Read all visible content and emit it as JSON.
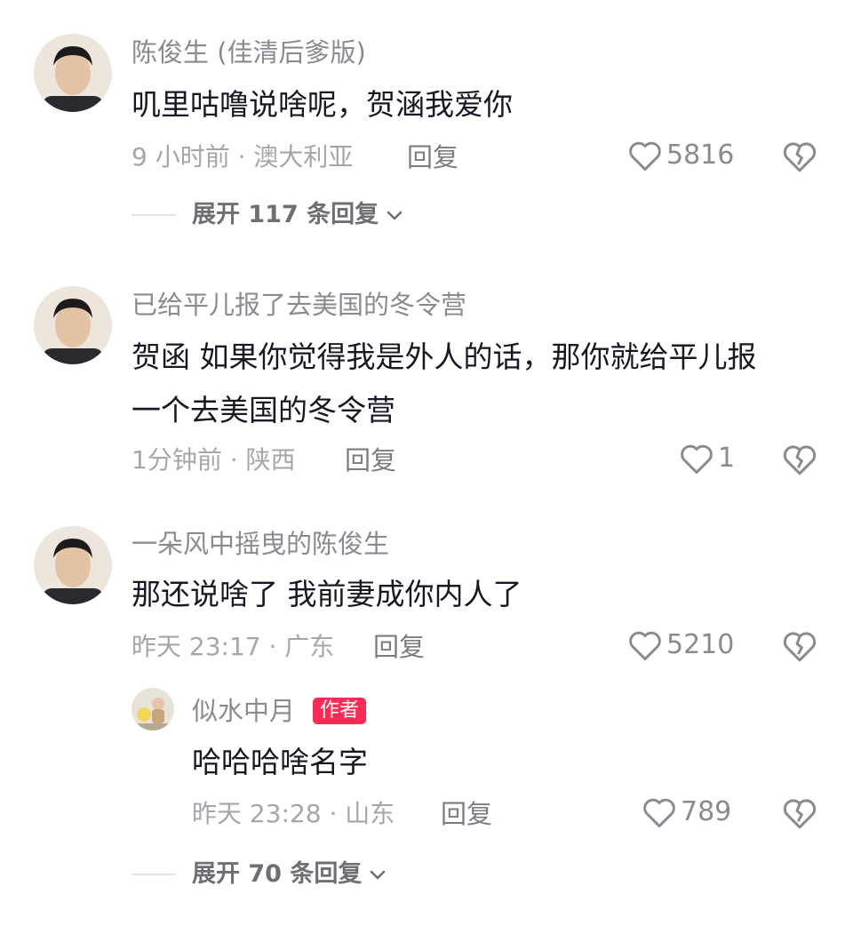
{
  "comments": [
    {
      "username": "陈俊生 (佳清后爹版)",
      "text_lines": [
        "叽里咕噜说啥呢，贺涵我爱你"
      ],
      "meta": "9 小时前 · 澳大利亚",
      "reply_label": "回复",
      "likes": "5816",
      "expand_label": "展开 117 条回复"
    },
    {
      "username": "已给平儿报了去美国的冬令营",
      "text_lines": [
        "贺函 如果你觉得我是外人的话，那你就给平儿报",
        "一个去美国的冬令营"
      ],
      "meta": "1分钟前 · 陕西",
      "reply_label": "回复",
      "likes": "1"
    },
    {
      "username": "一朵风中摇曳的陈俊生",
      "text_lines": [
        "那还说啥了 我前妻成你内人了"
      ],
      "meta": "昨天 23:17 · 广东",
      "reply_label": "回复",
      "likes": "5210",
      "reply": {
        "username": "似水中月",
        "badge": "作者",
        "text": "哈哈哈啥名字",
        "meta": "昨天 23:28 · 山东",
        "reply_label": "回复",
        "likes": "789"
      },
      "expand_label": "展开 70 条回复"
    }
  ],
  "icons": {
    "like": "heart-outline-icon",
    "dislike": "broken-heart-icon",
    "expand": "chevron-down-icon"
  },
  "colors": {
    "text": "#161823",
    "muted": "#a5a6ab",
    "username": "#8a8b91",
    "author_badge": "#fe2c55"
  }
}
